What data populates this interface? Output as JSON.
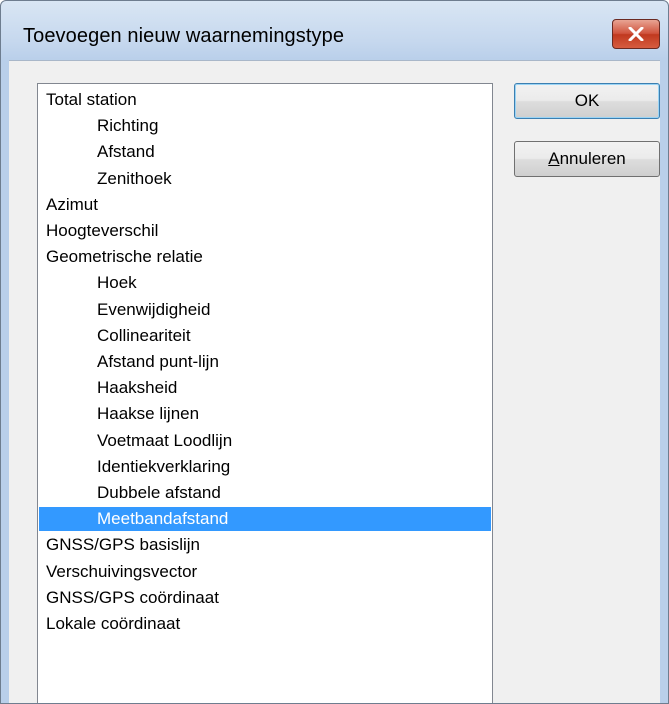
{
  "window": {
    "title": "Toevoegen nieuw waarnemingstype",
    "close_icon": "close-icon"
  },
  "list": {
    "items": [
      {
        "label": "Total station",
        "level": 0,
        "selected": false
      },
      {
        "label": "Richting",
        "level": 1,
        "selected": false
      },
      {
        "label": "Afstand",
        "level": 1,
        "selected": false
      },
      {
        "label": "Zenithoek",
        "level": 1,
        "selected": false
      },
      {
        "label": "Azimut",
        "level": 0,
        "selected": false
      },
      {
        "label": "Hoogteverschil",
        "level": 0,
        "selected": false
      },
      {
        "label": "Geometrische relatie",
        "level": 0,
        "selected": false
      },
      {
        "label": "Hoek",
        "level": 1,
        "selected": false
      },
      {
        "label": "Evenwijdigheid",
        "level": 1,
        "selected": false
      },
      {
        "label": "Collineariteit",
        "level": 1,
        "selected": false
      },
      {
        "label": "Afstand punt-lijn",
        "level": 1,
        "selected": false
      },
      {
        "label": "Haaksheid",
        "level": 1,
        "selected": false
      },
      {
        "label": "Haakse lijnen",
        "level": 1,
        "selected": false
      },
      {
        "label": "Voetmaat Loodlijn",
        "level": 1,
        "selected": false
      },
      {
        "label": "Identiekverklaring",
        "level": 1,
        "selected": false
      },
      {
        "label": "Dubbele afstand",
        "level": 1,
        "selected": false
      },
      {
        "label": "Meetbandafstand",
        "level": 1,
        "selected": true
      },
      {
        "label": "GNSS/GPS basislijn",
        "level": 0,
        "selected": false
      },
      {
        "label": "Verschuivingsvector",
        "level": 0,
        "selected": false
      },
      {
        "label": "GNSS/GPS coördinaat",
        "level": 0,
        "selected": false
      },
      {
        "label": "Lokale coördinaat",
        "level": 0,
        "selected": false
      }
    ]
  },
  "buttons": {
    "ok_label": "OK",
    "cancel_mnemonic": "A",
    "cancel_rest": "nnuleren"
  },
  "colors": {
    "selection": "#3399ff",
    "close_button": "#c7402a"
  }
}
